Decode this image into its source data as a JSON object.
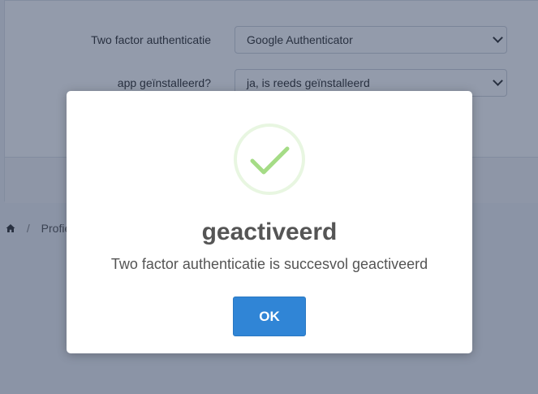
{
  "form": {
    "fields": [
      {
        "label": "Two factor authenticatie",
        "value": "Google Authenticator"
      },
      {
        "label": "app geïnstalleerd?",
        "value": "ja, is reeds geïnstalleerd"
      }
    ]
  },
  "breadcrumb": {
    "home_icon": "home-icon",
    "separator": "/",
    "current": "Profie"
  },
  "dialog": {
    "icon": "checkmark-success-icon",
    "icon_color": "#a5dc86",
    "title": "geactiveerd",
    "message": "Two factor authenticatie is succesvol geactiveerd",
    "confirm_label": "OK",
    "confirm_color": "#3085d6"
  }
}
